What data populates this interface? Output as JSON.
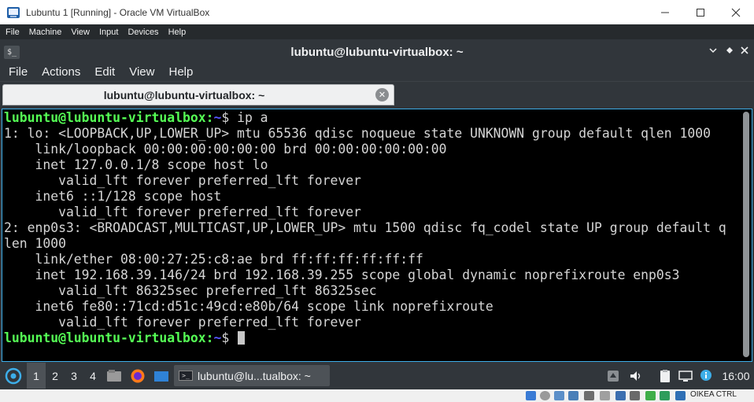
{
  "host_window": {
    "title": "Lubuntu 1 [Running] - Oracle VM VirtualBox",
    "icon": "virtualbox-icon",
    "controls": [
      "minimize-icon",
      "maximize-icon",
      "close-icon"
    ]
  },
  "host_menu": [
    "File",
    "Machine",
    "View",
    "Input",
    "Devices",
    "Help"
  ],
  "terminal_window": {
    "title": "lubuntu@lubuntu-virtualbox: ~",
    "icon_glyph": "$_",
    "controls": [
      "chevron-down-icon",
      "restore-icon",
      "close-icon"
    ]
  },
  "terminal_menu": [
    "File",
    "Actions",
    "Edit",
    "View",
    "Help"
  ],
  "tab": {
    "label": "lubuntu@lubuntu-virtualbox: ~"
  },
  "prompt": {
    "user": "lubuntu@lubuntu-virtualbox",
    "sep": ":",
    "path": "~",
    "symbol": "$ "
  },
  "command": "ip a",
  "output": [
    "1: lo: <LOOPBACK,UP,LOWER_UP> mtu 65536 qdisc noqueue state UNKNOWN group default qlen 1000",
    "    link/loopback 00:00:00:00:00:00 brd 00:00:00:00:00:00",
    "    inet 127.0.0.1/8 scope host lo",
    "       valid_lft forever preferred_lft forever",
    "    inet6 ::1/128 scope host",
    "       valid_lft forever preferred_lft forever",
    "2: enp0s3: <BROADCAST,MULTICAST,UP,LOWER_UP> mtu 1500 qdisc fq_codel state UP group default q",
    "len 1000",
    "    link/ether 08:00:27:25:c8:ae brd ff:ff:ff:ff:ff:ff",
    "    inet 192.168.39.146/24 brd 192.168.39.255 scope global dynamic noprefixroute enp0s3",
    "       valid_lft 86325sec preferred_lft 86325sec",
    "    inet6 fe80::71cd:d51c:49cd:e80b/64 scope link noprefixroute",
    "       valid_lft forever preferred_lft forever"
  ],
  "panel": {
    "desktops": [
      "1",
      "2",
      "3",
      "4"
    ],
    "active_desktop": "1",
    "task_label": "lubuntu@lu...tualbox: ~",
    "clock": "16:00"
  },
  "host_status": {
    "host_key": "OIKEA CTRL"
  },
  "colors": {
    "prompt_user": "#55ff55",
    "prompt_path": "#5555ff",
    "terminal_bg": "#000000",
    "terminal_fg": "#d5d5d5",
    "chrome_bg": "#31363b",
    "focus_border": "#3daee9"
  }
}
